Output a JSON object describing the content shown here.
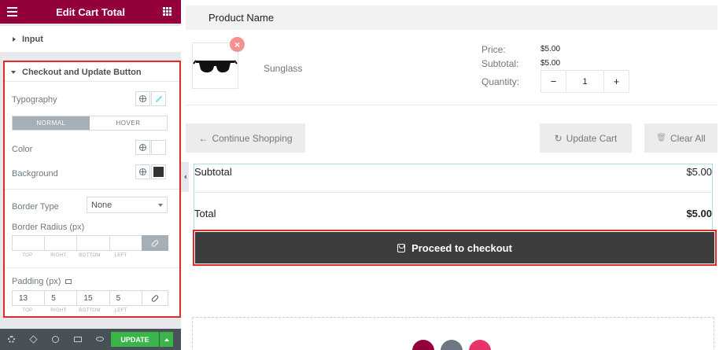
{
  "panel": {
    "title": "Edit Cart Total",
    "input_section": "Input",
    "checkout_section": "Checkout and Update Button",
    "typography_label": "Typography",
    "tabs": [
      {
        "label": "NORMAL"
      },
      {
        "label": "HOVER"
      }
    ],
    "color_label": "Color",
    "background_label": "Background",
    "background_swatch": "#333333",
    "border_type_label": "Border Type",
    "border_type_value": "None",
    "border_radius_label": "Border Radius (px)",
    "border_radius": {
      "values": [
        "",
        "",
        "",
        ""
      ],
      "labels": [
        "TOP",
        "RIGHT",
        "BOTTOM",
        "LEFT"
      ],
      "linked": true
    },
    "padding_label": "Padding (px)",
    "padding": {
      "values": [
        "13",
        "5",
        "15",
        "5"
      ],
      "labels": [
        "TOP",
        "RIGHT",
        "BOTTOM",
        "LEFT"
      ],
      "linked": false
    },
    "update_label": "UPDATE",
    "header_color": "#93003c",
    "update_color": "#39b54a"
  },
  "product_table": {
    "header": "Product Name",
    "item": {
      "name": "Sunglass",
      "remove_glyph": "×",
      "price_label": "Price:",
      "price": "$5.00",
      "subtotal_label": "Subtotal:",
      "subtotal": "$5.00",
      "quantity_label": "Quantity:",
      "quantity": "1",
      "minus": "−",
      "plus": "+"
    }
  },
  "actions": {
    "continue_icon": "←",
    "continue_label": "Continue Shopping",
    "update_icon": "↻",
    "update_label": "Update Cart",
    "clear_icon": "🗑",
    "clear_label": "Clear All"
  },
  "totals": {
    "subtotal_label": "Subtotal",
    "subtotal_value": "$5.00",
    "total_label": "Total",
    "total_value": "$5.00",
    "checkout_label": "Proceed to checkout"
  },
  "dropzone": {
    "button_colors": [
      "#93003c",
      "#6d7882",
      "#e8336a"
    ]
  }
}
